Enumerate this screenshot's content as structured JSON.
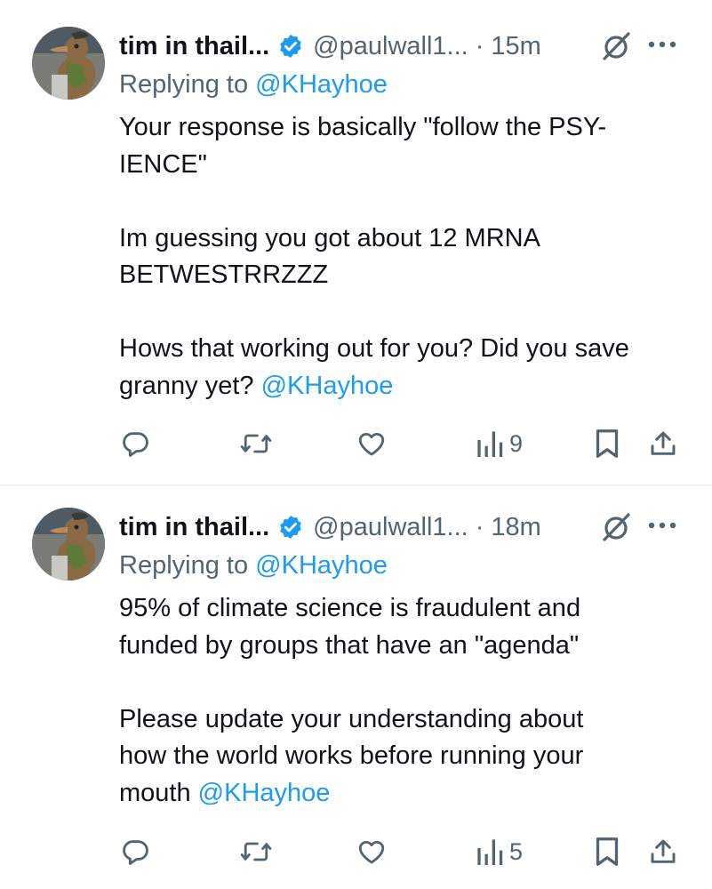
{
  "tweets": [
    {
      "author": {
        "display_name": "tim in thail...",
        "handle": "@paulwall1...",
        "verified": true,
        "avatar": "troll-figurine-avatar"
      },
      "time": "· 15m",
      "reply_to": {
        "prefix": "Replying to ",
        "mention": "@KHayhoe"
      },
      "body_lines": [
        "Your response is basically \"follow the PSY-",
        "IENCE\"",
        "",
        "Im guessing you got about 12 MRNA",
        "BETWESTRRZZZ",
        "",
        "Hows that working out for you? Did you save"
      ],
      "body_last": {
        "text": "granny yet? ",
        "mention": "@KHayhoe"
      },
      "views": "9"
    },
    {
      "author": {
        "display_name": "tim in thail...",
        "handle": "@paulwall1...",
        "verified": true,
        "avatar": "troll-figurine-avatar"
      },
      "time": "· 18m",
      "reply_to": {
        "prefix": "Replying to ",
        "mention": "@KHayhoe"
      },
      "body_lines": [
        "95% of climate science is fraudulent and",
        "funded by groups that have an \"agenda\"",
        "",
        "Please update your understanding about",
        "how the world works before running your"
      ],
      "body_last": {
        "text": "mouth ",
        "mention": "@KHayhoe"
      },
      "views": "5"
    }
  ],
  "icons": {
    "reply": "speech-bubble-icon",
    "retweet": "repost-arrows-icon",
    "like": "heart-outline-icon",
    "views": "bar-chart-icon",
    "bookmark": "bookmark-icon",
    "share": "share-upload-icon",
    "grok": "grok-slash-circle-icon",
    "more": "three-dots-icon",
    "verified": "verified-badge-icon"
  },
  "colors": {
    "text": "#0f1419",
    "secondary": "#536471",
    "accent": "#1d9bf0",
    "divider": "#eff3f4"
  }
}
